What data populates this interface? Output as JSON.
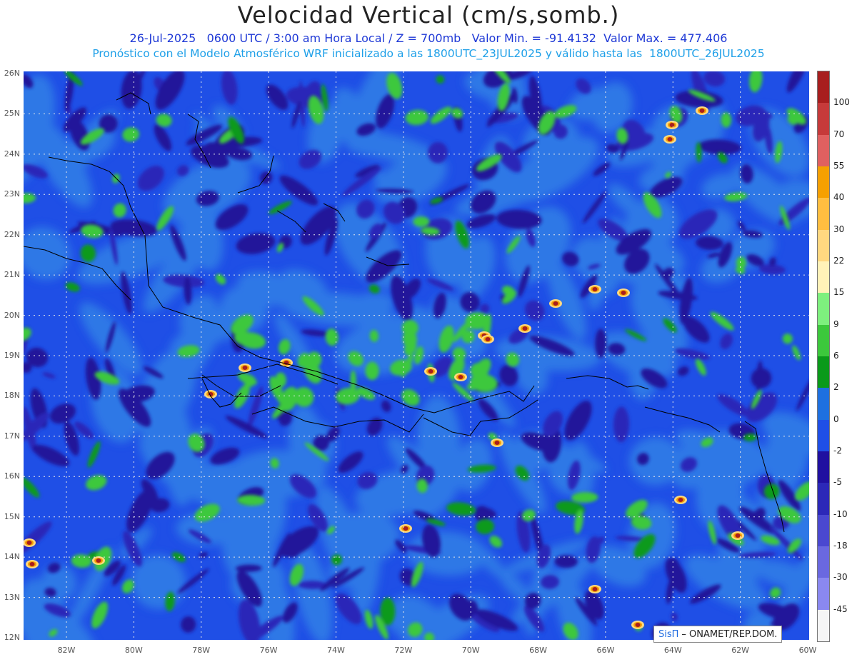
{
  "header": {
    "title": "Velocidad Vertical (cm/s,somb.)",
    "line1": "26-Jul-2025   0600 UTC / 3:00 am Hora Local / Z = 700mb   Valor Min. = -91.4132  Valor Max. = 477.406",
    "line2": "Pronóstico con el Modelo Atmosférico WRF inicializado a las 1800UTC_23JUL2025 y válido hasta las  1800UTC_26JUL2025"
  },
  "axes": {
    "lat_labels": [
      "26N",
      "25N",
      "24N",
      "23N",
      "22N",
      "21N",
      "20N",
      "19N",
      "18N",
      "17N",
      "16N",
      "15N",
      "14N",
      "13N",
      "12N"
    ],
    "lon_labels": [
      "82W",
      "80W",
      "78W",
      "76W",
      "74W",
      "72W",
      "70W",
      "68W",
      "66W",
      "64W",
      "62W",
      "60W"
    ]
  },
  "colorbar": {
    "labels": [
      "100",
      "70",
      "55",
      "40",
      "30",
      "22",
      "15",
      "9",
      "6",
      "2",
      "0",
      "-2",
      "-5",
      "-10",
      "-18",
      "-30",
      "-45"
    ],
    "colors": [
      "#a81e1e",
      "#c63a3a",
      "#e06060",
      "#f5a000",
      "#ffbe40",
      "#ffd880",
      "#fff2b8",
      "#7ef07e",
      "#3cc83c",
      "#0a9a1a",
      "#1e70e0",
      "#1f4fe6",
      "#2010a0",
      "#2c28b8",
      "#4a48d0",
      "#6a68e0",
      "#8a88f0",
      "#f5f5f5"
    ]
  },
  "credit": {
    "brand": "SisΠ",
    "text": "– ONAMET/REP.DOM."
  }
}
